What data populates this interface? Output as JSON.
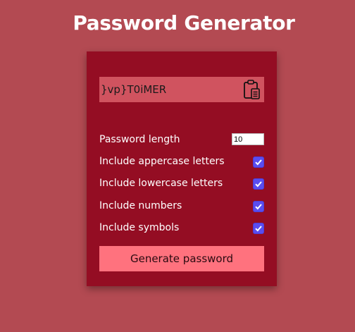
{
  "title": "Password Generator",
  "result": {
    "password": "}vp}T0iMER",
    "clipboard_icon": "clipboard-icon"
  },
  "options": {
    "length_label": "Password length",
    "length_value": "10",
    "items": [
      {
        "label": "Include appercase letters",
        "checked": true
      },
      {
        "label": "Include lowercase letters",
        "checked": true
      },
      {
        "label": "Include numbers",
        "checked": true
      },
      {
        "label": "Include symbols",
        "checked": true
      }
    ]
  },
  "generate_label": "Generate password",
  "colors": {
    "background": "#b34a52",
    "card": "#940d23",
    "result_bg": "#d0535f",
    "button": "#ff727e",
    "checkbox": "#5a4df0"
  }
}
